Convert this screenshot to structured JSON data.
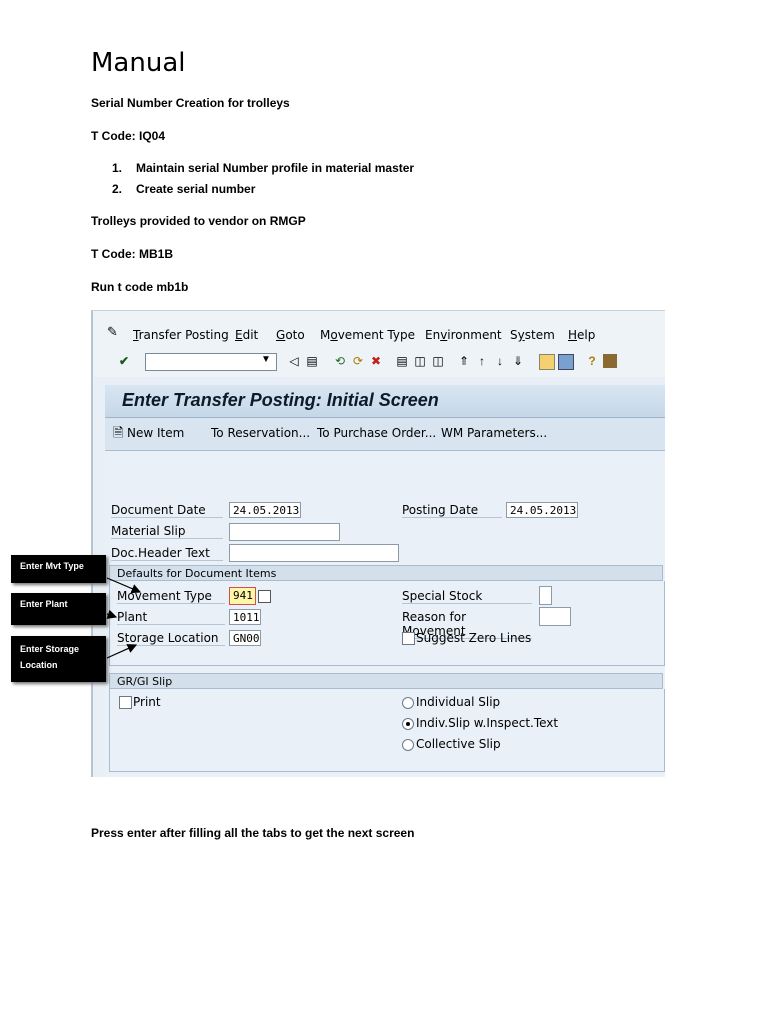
{
  "document": {
    "title": "Manual",
    "line1": "Serial Number Creation for trolleys",
    "line2": "T Code: IQ04",
    "steps": [
      {
        "num": "1.",
        "text": "Maintain serial Number profile in material master"
      },
      {
        "num": "2.",
        "text": "Create serial number"
      }
    ],
    "line3": "Trolleys provided to vendor on RMGP",
    "line4": "T Code: MB1B",
    "line5": "Run t code mb1b",
    "footer": "Press enter after filling all the tabs to get the next screen"
  },
  "sap": {
    "menu": [
      {
        "pre": "",
        "u": "T",
        "post": "ransfer Posting"
      },
      {
        "pre": "",
        "u": "E",
        "post": "dit"
      },
      {
        "pre": "",
        "u": "G",
        "post": "oto"
      },
      {
        "pre": "M",
        "u": "o",
        "post": "vement Type"
      },
      {
        "pre": "En",
        "u": "v",
        "post": "ironment"
      },
      {
        "pre": "S",
        "u": "y",
        "post": "stem"
      },
      {
        "pre": "",
        "u": "H",
        "post": "elp"
      }
    ],
    "screen_title": "Enter Transfer Posting: Initial Screen",
    "app_toolbar": {
      "new_item": "New Item",
      "to_reservation": "To Reservation...",
      "to_purchase_order": "To Purchase Order...",
      "wm_parameters": "WM Parameters..."
    },
    "header": {
      "document_date_label": "Document Date",
      "document_date": "24.05.2013",
      "posting_date_label": "Posting Date",
      "posting_date": "24.05.2013",
      "material_slip_label": "Material Slip",
      "material_slip": "",
      "doc_header_text_label": "Doc.Header Text",
      "doc_header_text": ""
    },
    "defaults": {
      "group_title": "Defaults for Document Items",
      "movement_type_label": "Movement Type",
      "movement_type": "941",
      "plant_label": "Plant",
      "plant": "1011",
      "storage_location_label": "Storage Location",
      "storage_location": "GN00",
      "special_stock_label": "Special Stock",
      "special_stock": "",
      "reason_label": "Reason for Movement",
      "reason": "",
      "suggest_zero_lines_label": "Suggest Zero Lines"
    },
    "slip": {
      "group_title": "GR/GI Slip",
      "print_label": "Print",
      "individual_slip": "Individual Slip",
      "indiv_slip_inspect": "Indiv.Slip w.Inspect.Text",
      "collective_slip": "Collective Slip",
      "selected": "indiv_slip_inspect"
    }
  },
  "annotations": {
    "mvt_type": "Enter Mvt Type",
    "plant": "Enter Plant",
    "storage_line1": "Enter Storage",
    "storage_line2": "Location"
  }
}
